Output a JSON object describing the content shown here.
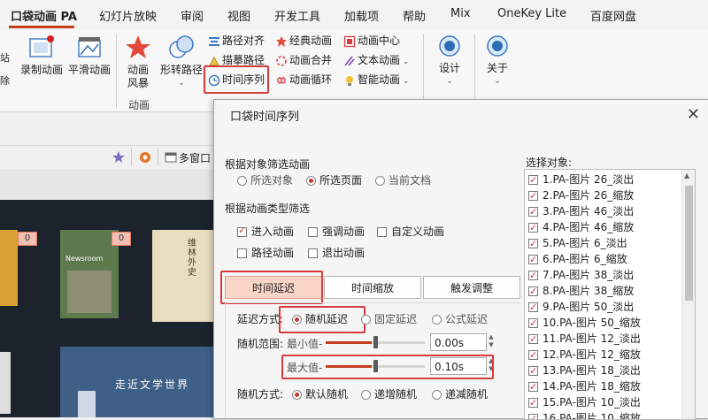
{
  "tabs": [
    "口袋动画 PA",
    "幻灯片放映",
    "审阅",
    "视图",
    "开发工具",
    "加载项",
    "帮助",
    "Mix",
    "OneKey Lite",
    "百度网盘"
  ],
  "ribbon": {
    "large_buttons": [
      "录制动画",
      "平滑动画",
      "动画\n风暴",
      "形转路径"
    ],
    "small_col1": [
      "路径对齐",
      "描摹路径",
      "时间序列"
    ],
    "small_col2": [
      "经典动画",
      "动画合并",
      "动画循环"
    ],
    "small_col3": [
      "动画中心",
      "文本动画",
      "智能动画"
    ],
    "group_label": "动画",
    "design_label": "设计",
    "about_label": "关于",
    "left_clip": [
      "站",
      "除"
    ]
  },
  "status": {
    "multi_window": "多窗口"
  },
  "slide": {
    "badges": [
      "0",
      "0"
    ],
    "book_texts": [
      "Newsroom",
      "走近文学世界",
      "维林外史"
    ]
  },
  "dialog": {
    "title": "口袋时间序列",
    "close": "✕",
    "filter_by_object": "根据对象筛选动画",
    "object_options": [
      "所选对象",
      "所选页面",
      "当前文档"
    ],
    "object_selected": 1,
    "filter_by_type": "根据动画类型筛选",
    "type_options": [
      "进入动画",
      "强调动画",
      "自定义动画",
      "路径动画",
      "退出动画"
    ],
    "type_checked": [
      true,
      false,
      false,
      false,
      false
    ],
    "tabs": [
      "时间延迟",
      "时间缩放",
      "触发调整"
    ],
    "active_tab": 0,
    "delay_mode_label": "延迟方式:",
    "delay_modes": [
      "随机延迟",
      "固定延迟",
      "公式延迟"
    ],
    "random_range_label": "随机范围:",
    "min_label": "最小值-",
    "max_label": "最大值-",
    "min_value": "0.00s",
    "max_value": "0.10s",
    "min_slider_fraction": 0.46,
    "max_slider_fraction": 0.46,
    "random_mode_label": "随机方式:",
    "random_modes": [
      "默认随机",
      "递增随机",
      "递减随机"
    ],
    "select_objects_label": "选择对象:",
    "objects": [
      "1.PA-图片 26_淡出",
      "2.PA-图片 26_缩放",
      "3.PA-图片 46_淡出",
      "4.PA-图片 46_缩放",
      "5.PA-图片 6_淡出",
      "6.PA-图片 6_缩放",
      "7.PA-图片 38_淡出",
      "8.PA-图片 38_缩放",
      "9.PA-图片 50_淡出",
      "10.PA-图片 50_缩放",
      "11.PA-图片 12_淡出",
      "12.PA-图片 12_缩放",
      "13.PA-图片 18_淡出",
      "14.PA-图片 18_缩放",
      "15.PA-图片 10_淡出",
      "16.PA-图片 10_缩放"
    ]
  },
  "colors": {
    "accent": "#c43e1c",
    "highlight": "#d63a3a",
    "selected_tab": "#fad4c6"
  }
}
